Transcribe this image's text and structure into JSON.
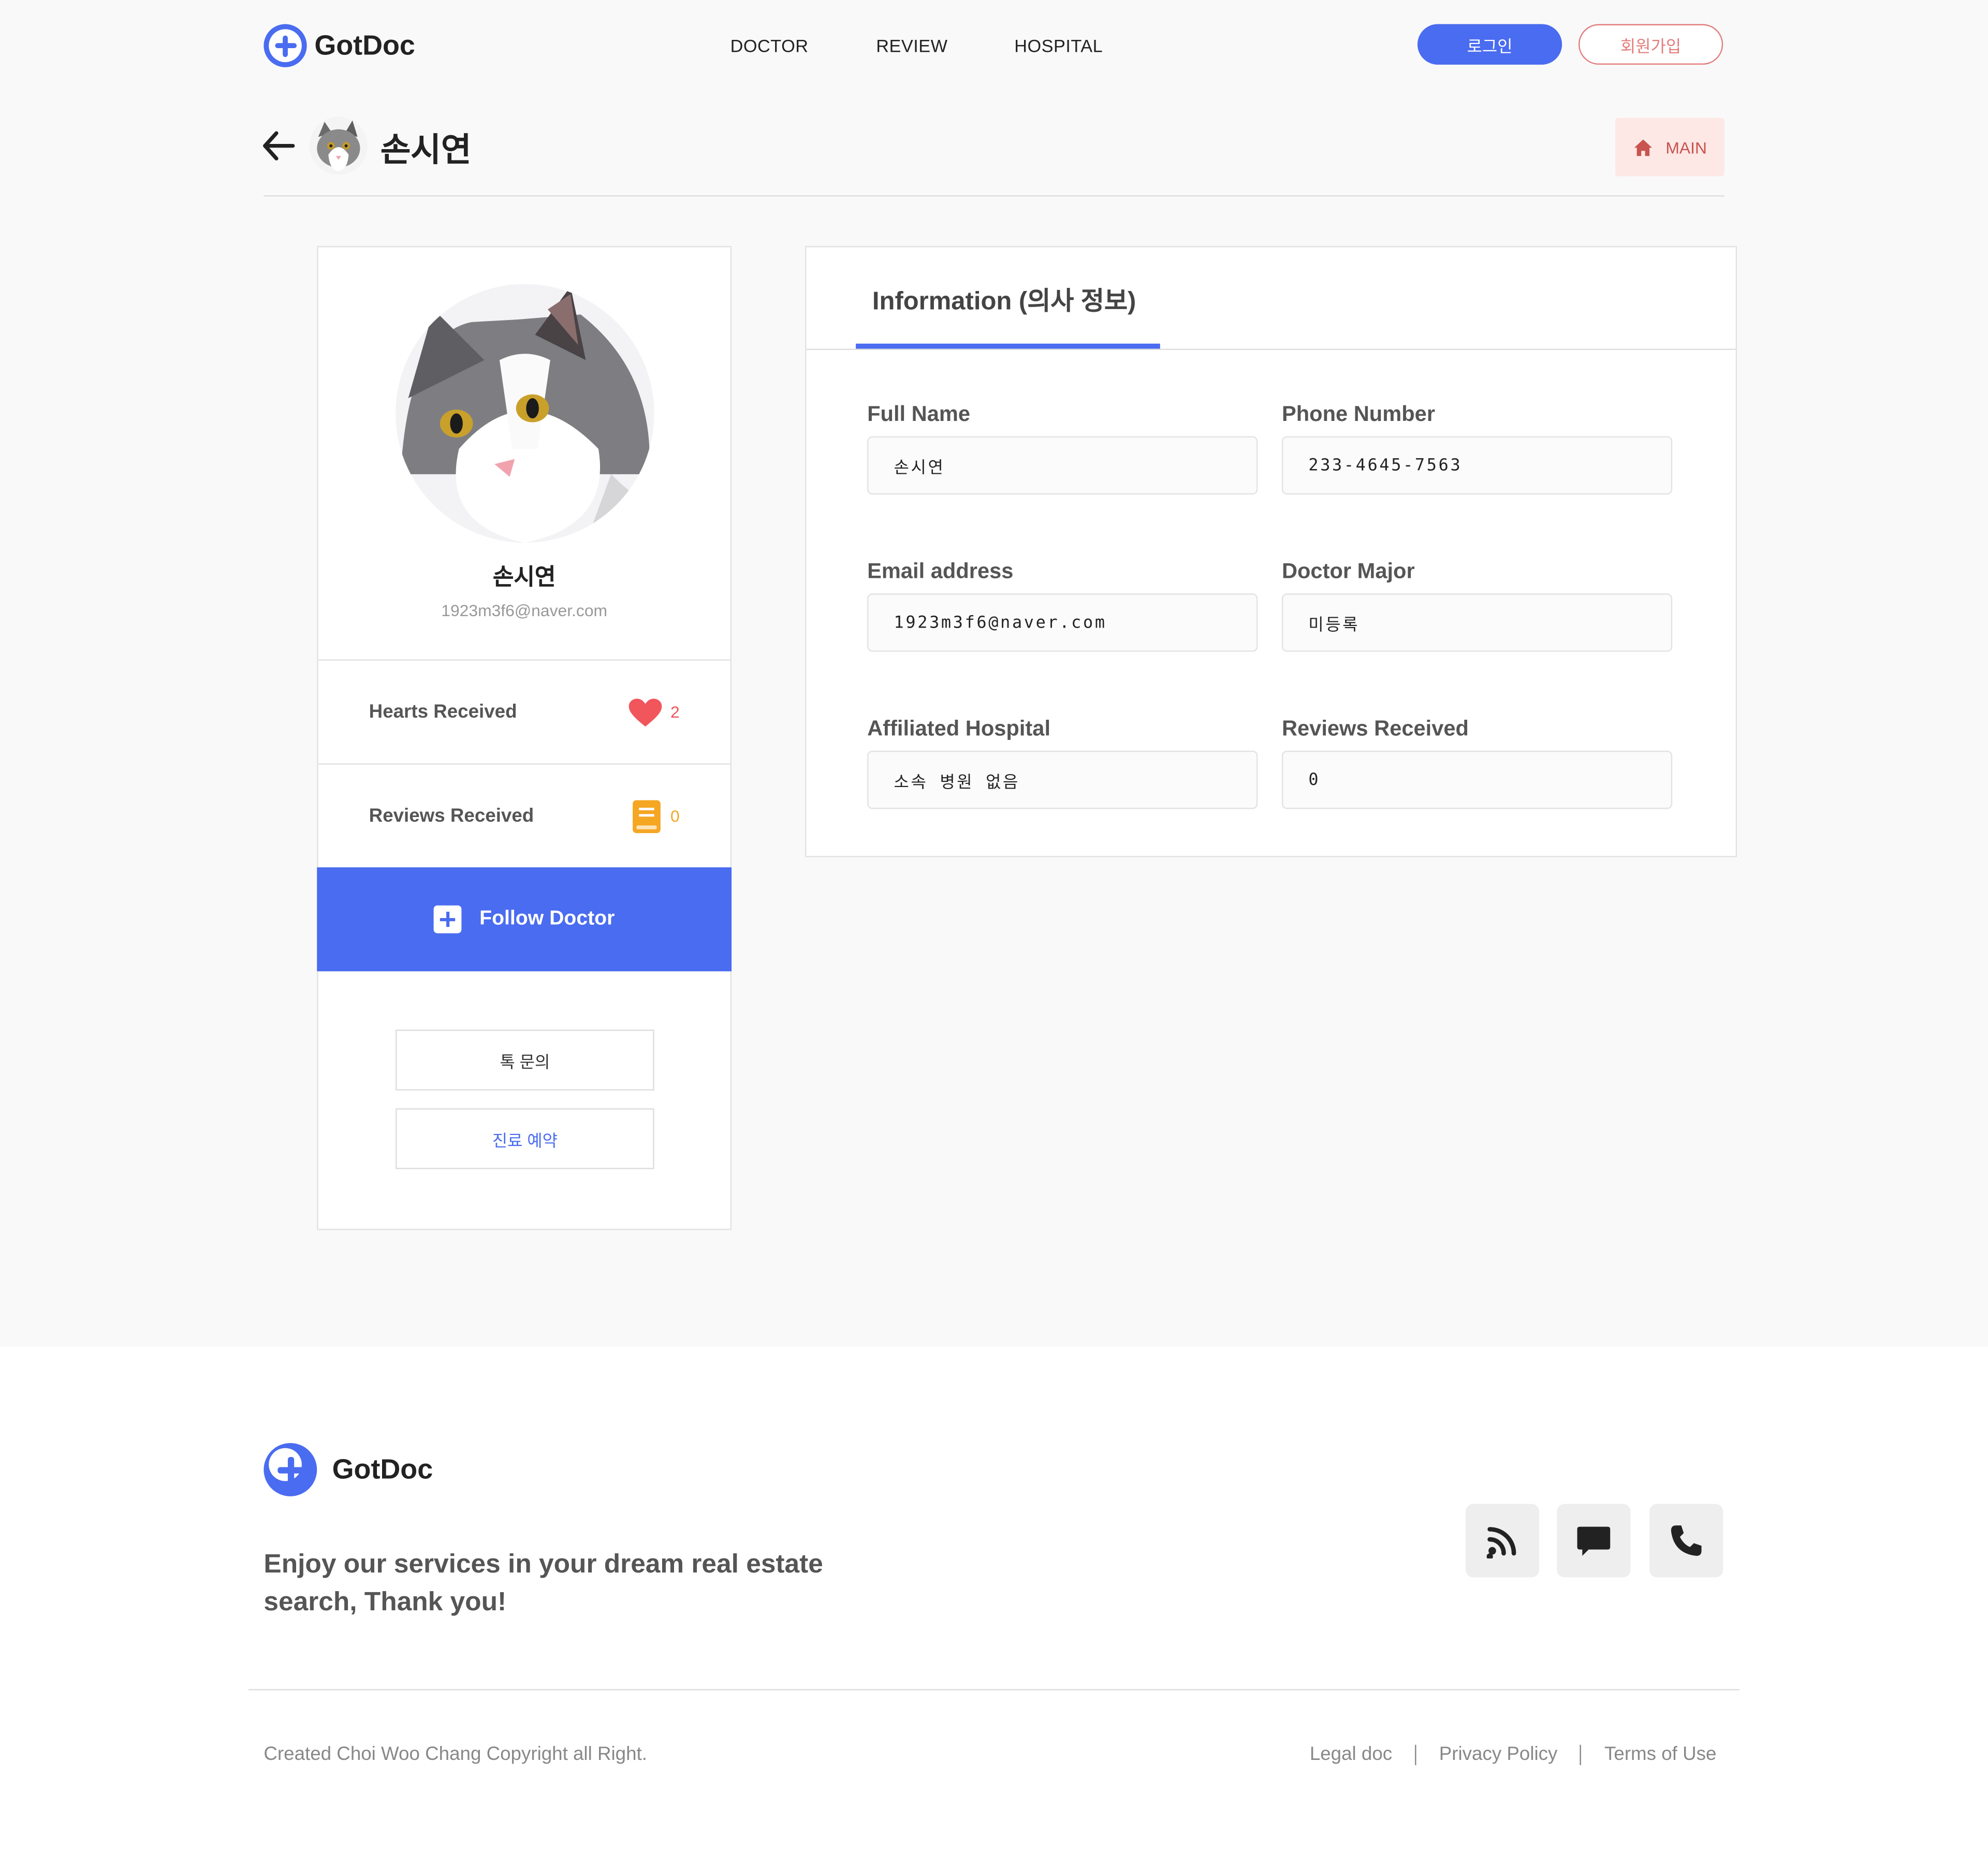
{
  "header": {
    "logo_text": "GotDoc",
    "nav": [
      "DOCTOR",
      "REVIEW",
      "HOSPITAL"
    ],
    "login_label": "로그인",
    "signup_label": "회원가입"
  },
  "title_bar": {
    "doctor_name": "손시연",
    "main_button_label": "MAIN"
  },
  "profile": {
    "name": "손시연",
    "email": "1923m3f6@naver.com",
    "hearts_label": "Hearts Received",
    "hearts_count": "2",
    "reviews_label": "Reviews Received",
    "reviews_count": "0",
    "follow_label": "Follow Doctor",
    "talk_button_label": "톡 문의",
    "reserve_button_label": "진료 예약"
  },
  "information": {
    "tab_title": "Information (의사 정보)",
    "fields": [
      {
        "label": "Full Name",
        "value": "손시연"
      },
      {
        "label": "Phone Number",
        "value": "233-4645-7563"
      },
      {
        "label": "Email address",
        "value": "1923m3f6@naver.com"
      },
      {
        "label": "Doctor Major",
        "value": "미등록"
      },
      {
        "label": "Affiliated Hospital",
        "value": "소속 병원 없음"
      },
      {
        "label": "Reviews Received",
        "value": "0"
      }
    ]
  },
  "footer": {
    "logo_text": "GotDoc",
    "tagline_line1": "Enjoy our services in your dream real estate",
    "tagline_line2": "search, Thank you!",
    "copyright": "Created Choi Woo Chang Copyright all Right.",
    "links": [
      "Legal doc",
      "Privacy Policy",
      "Terms of Use"
    ]
  },
  "colors": {
    "accent": "#4a6cf0",
    "heart": "#f0565c",
    "review_icon": "#f5a623",
    "signup_border": "#e37c7c",
    "main_button_bg": "#fde8e6"
  },
  "icons": [
    "logo-plus-icon",
    "back-arrow-icon",
    "home-icon",
    "heart-icon",
    "book-icon",
    "plus-box-icon",
    "rss-icon",
    "chat-icon",
    "phone-icon"
  ]
}
